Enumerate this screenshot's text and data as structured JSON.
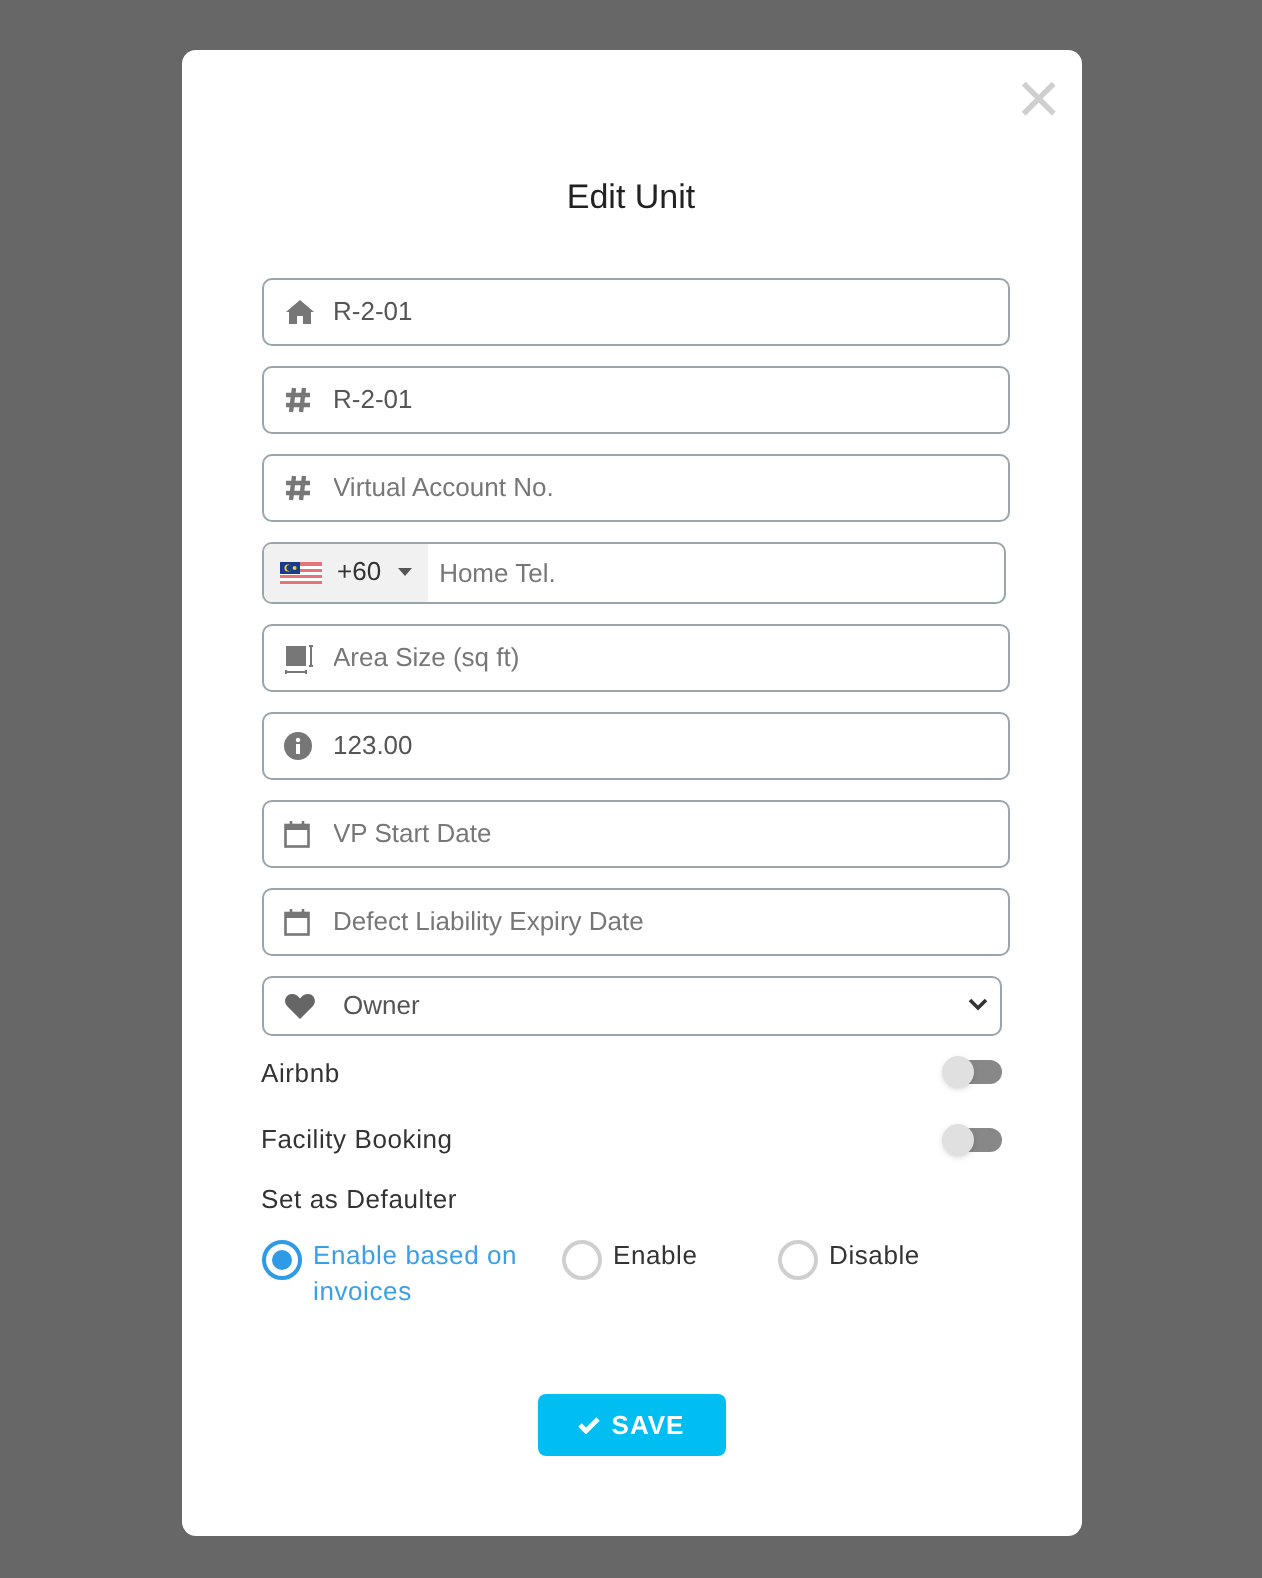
{
  "dialog": {
    "title": "Edit Unit",
    "close": "×"
  },
  "fields": [
    {
      "kind": "text",
      "value": "R-2-01"
    },
    {
      "kind": "text",
      "value": "R-2-01"
    },
    {
      "kind": "text",
      "placeholder": "Virtual Account No."
    },
    {
      "kind": "phone",
      "code": "+60",
      "placeholder": "Home Tel."
    },
    {
      "kind": "text",
      "placeholder": "Area Size (sq ft)"
    },
    {
      "kind": "text",
      "value": "123.00"
    },
    {
      "kind": "date",
      "placeholder": "VP Start Date"
    },
    {
      "kind": "date",
      "placeholder": "Defect Liability Expiry Date"
    },
    {
      "kind": "select",
      "value": "Owner"
    }
  ],
  "toggles": [
    {
      "label": "Airbnb",
      "on": false
    },
    {
      "label": "Facility Booking",
      "on": false
    }
  ],
  "defaulter": {
    "label": "Set as Defaulter",
    "options": [
      {
        "label": "Enable based on invoices",
        "selected": true
      },
      {
        "label": "Enable",
        "selected": false
      },
      {
        "label": "Disable",
        "selected": false
      }
    ]
  },
  "save_button": "SAVE"
}
